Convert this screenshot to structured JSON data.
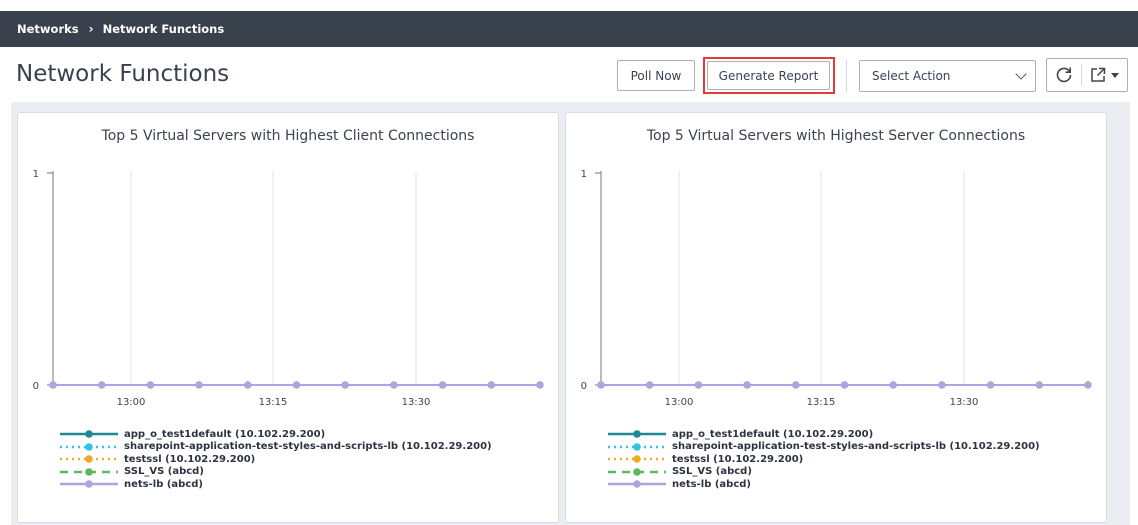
{
  "breadcrumb": {
    "root": "Networks",
    "separator": "›",
    "current": "Network Functions"
  },
  "header": {
    "title": "Network Functions",
    "poll_label": "Poll Now",
    "report_label": "Generate Report",
    "select_action": "Select Action"
  },
  "colors": {
    "breadcrumb_bg": "#39414d",
    "highlight": "#e33a3a",
    "content_bg": "#eaeef2"
  },
  "icons": [
    "chevron-right-icon",
    "chevron-down-icon",
    "refresh-icon",
    "external-link-icon",
    "caret-down-icon"
  ],
  "panels": [
    {
      "title": "Top 5 Virtual Servers with Highest Client Connections"
    },
    {
      "title": "Top 5 Virtual Servers with Highest Server Connections"
    }
  ],
  "chart_data": [
    {
      "type": "line",
      "title": "Top 5 Virtual Servers with Highest Client Connections",
      "xlabel": "",
      "ylabel": "",
      "yticks": [
        "1",
        "0"
      ],
      "xticks": [
        "13:00",
        "13:15",
        "13:30"
      ],
      "ylim": [
        0,
        1
      ],
      "grid": "vertical",
      "legend_position": "bottom",
      "series": [
        {
          "name": "app_o_test1default (10.102.29.200)",
          "color": "#1a8a95",
          "style": "solid",
          "values": [
            0,
            0,
            0,
            0,
            0,
            0,
            0,
            0,
            0,
            0,
            0
          ]
        },
        {
          "name": "sharepoint-application-test-styles-and-scripts-lb (10.102.29.200)",
          "color": "#2ec5e8",
          "style": "dotted",
          "values": [
            0,
            0,
            0,
            0,
            0,
            0,
            0,
            0,
            0,
            0,
            0
          ]
        },
        {
          "name": "testssl (10.102.29.200)",
          "color": "#f5a623",
          "style": "dotted",
          "values": [
            0,
            0,
            0,
            0,
            0,
            0,
            0,
            0,
            0,
            0,
            0
          ]
        },
        {
          "name": "SSL_VS (abcd)",
          "color": "#5cb85c",
          "style": "dashed",
          "values": [
            0,
            0,
            0,
            0,
            0,
            0,
            0,
            0,
            0,
            0,
            0
          ]
        },
        {
          "name": "nets-lb (abcd)",
          "color": "#a9a6e0",
          "style": "solid",
          "values": [
            0,
            0,
            0,
            0,
            0,
            0,
            0,
            0,
            0,
            0,
            0
          ]
        }
      ]
    },
    {
      "type": "line",
      "title": "Top 5 Virtual Servers with Highest Server Connections",
      "xlabel": "",
      "ylabel": "",
      "yticks": [
        "1",
        "0"
      ],
      "xticks": [
        "13:00",
        "13:15",
        "13:30"
      ],
      "ylim": [
        0,
        1
      ],
      "grid": "vertical",
      "legend_position": "bottom",
      "series": [
        {
          "name": "app_o_test1default (10.102.29.200)",
          "color": "#1a8a95",
          "style": "solid",
          "values": [
            0,
            0,
            0,
            0,
            0,
            0,
            0,
            0,
            0,
            0,
            0
          ]
        },
        {
          "name": "sharepoint-application-test-styles-and-scripts-lb (10.102.29.200)",
          "color": "#2ec5e8",
          "style": "dotted",
          "values": [
            0,
            0,
            0,
            0,
            0,
            0,
            0,
            0,
            0,
            0,
            0
          ]
        },
        {
          "name": "testssl (10.102.29.200)",
          "color": "#f5a623",
          "style": "dotted",
          "values": [
            0,
            0,
            0,
            0,
            0,
            0,
            0,
            0,
            0,
            0,
            0
          ]
        },
        {
          "name": "SSL_VS (abcd)",
          "color": "#5cb85c",
          "style": "dashed",
          "values": [
            0,
            0,
            0,
            0,
            0,
            0,
            0,
            0,
            0,
            0,
            0
          ]
        },
        {
          "name": "nets-lb (abcd)",
          "color": "#a9a6e0",
          "style": "solid",
          "values": [
            0,
            0,
            0,
            0,
            0,
            0,
            0,
            0,
            0,
            0,
            0
          ]
        }
      ]
    }
  ]
}
